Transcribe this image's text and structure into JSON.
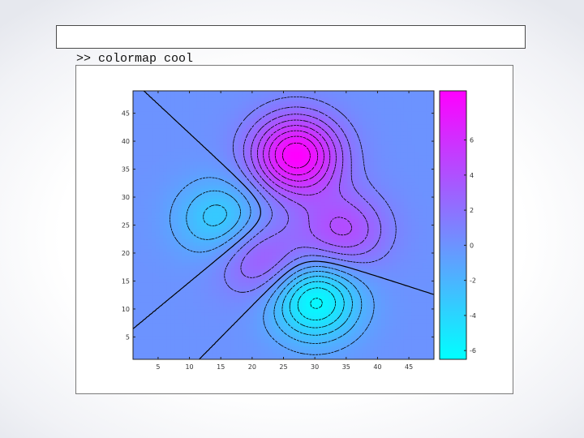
{
  "command": {
    "text": ">> colormap cool"
  },
  "chart_data": {
    "type": "heatmap",
    "title": "",
    "xlabel": "",
    "ylabel": "",
    "colormap": "cool",
    "colormap_stops": [
      "#00ffff",
      "#ff00ff"
    ],
    "grid": false,
    "contour_color": "#000000",
    "xlim": [
      1,
      49
    ],
    "ylim": [
      1,
      49
    ],
    "x_ticks": [
      5,
      10,
      15,
      20,
      25,
      30,
      35,
      40,
      45
    ],
    "y_ticks": [
      5,
      10,
      15,
      20,
      25,
      30,
      35,
      40,
      45
    ],
    "x_tick_labels": [
      "5",
      "10",
      "15",
      "20",
      "25",
      "30",
      "35",
      "40",
      "45"
    ],
    "y_tick_labels": [
      "5",
      "10",
      "15",
      "20",
      "25",
      "30",
      "35",
      "40",
      "45"
    ],
    "colorbar": {
      "placement": "right",
      "range": [
        -6.5,
        8.8
      ],
      "ticks": [
        -6,
        -4,
        -2,
        0,
        2,
        4,
        6
      ],
      "tick_labels": [
        "-6",
        "-4",
        "-2",
        "0",
        "2",
        "4",
        "6"
      ]
    },
    "peaks": [
      {
        "x": 27,
        "y": 37.5,
        "z": 8.8
      },
      {
        "x": 15,
        "y": 26,
        "z": -3.8
      },
      {
        "x": 21.5,
        "y": 19,
        "z": 3.8
      },
      {
        "x": 34.5,
        "y": 24,
        "z": 4.2
      },
      {
        "x": 30,
        "y": 11.5,
        "z": -6.5
      }
    ],
    "contour_levels": [
      -6,
      -5,
      -4,
      -3,
      -2,
      -1,
      0,
      1,
      2,
      3,
      4,
      5,
      6,
      7,
      8
    ]
  }
}
